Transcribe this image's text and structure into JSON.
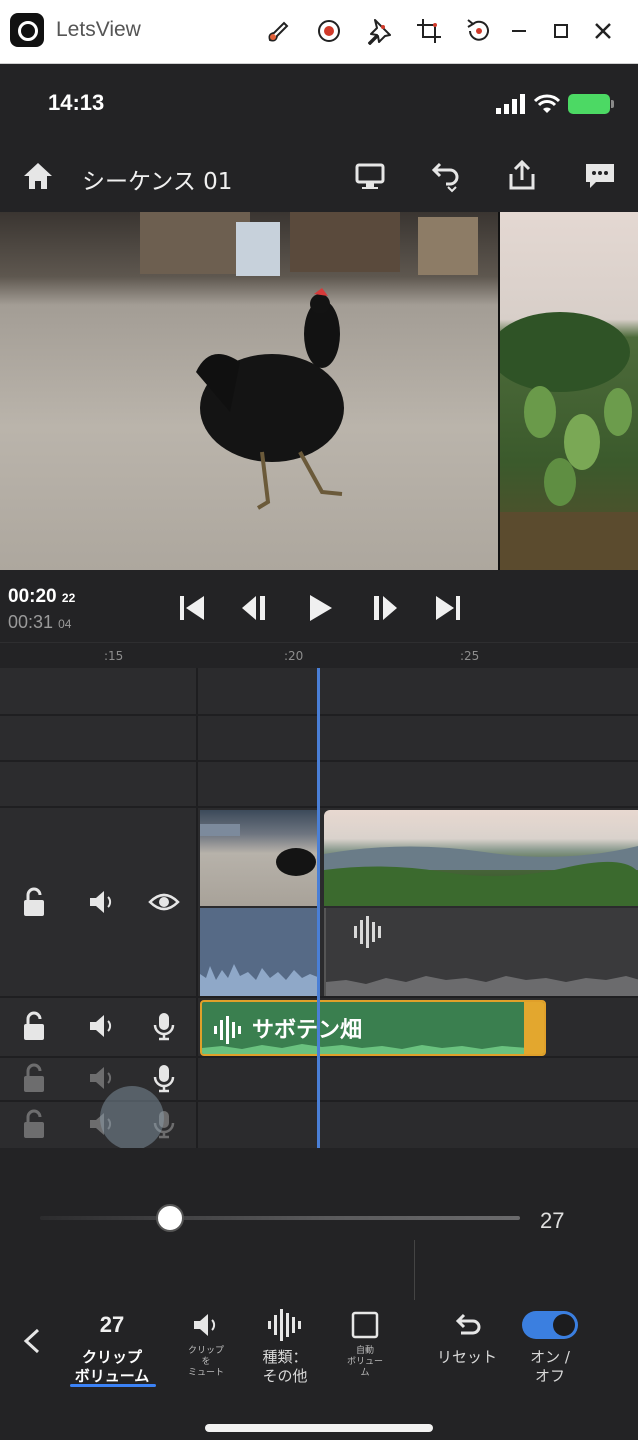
{
  "host_window": {
    "app_name": "LetsView"
  },
  "status_bar": {
    "time": "14:13"
  },
  "app_bar": {
    "sequence_title": "シーケンス 01"
  },
  "transport": {
    "current_time": "00:20",
    "current_frames": "22",
    "total_time": "00:31",
    "total_frames": "04"
  },
  "ruler": {
    "ticks": [
      ":15",
      ":20",
      ":25"
    ]
  },
  "timeline": {
    "audio_clip_label": "サボテン畑"
  },
  "volume_slider": {
    "value": 27,
    "display": "27"
  },
  "bottom_toolbar": {
    "items": [
      {
        "value": "27",
        "label_line1": "クリップ",
        "label_line2": "ボリューム"
      },
      {
        "label_line1": "クリップ",
        "label_line2": "を",
        "label_line3": "ミュート"
      },
      {
        "label_line1": "種類：",
        "label_line2": "その他"
      },
      {
        "label_line1": "自動",
        "label_line2": "ボリュー",
        "label_line3": "ム"
      },
      {
        "label_line1": "リセット"
      },
      {
        "label_line1": "オン /",
        "label_line2": "オフ"
      }
    ]
  },
  "colors": {
    "accent_blue": "#3b82f6",
    "playhead": "#4a7fd6",
    "audio_clip_green": "#3a7f4f",
    "audio_clip_border": "#e0a02a",
    "battery": "#4cd964"
  }
}
